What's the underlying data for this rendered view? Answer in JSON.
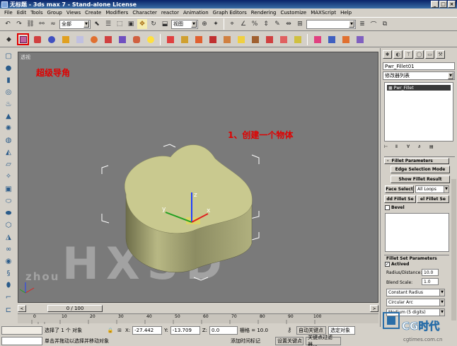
{
  "window": {
    "title": "无标题 - 3ds max 7 - Stand-alone License",
    "min": "_",
    "max": "□",
    "close": "×"
  },
  "menu": [
    "File",
    "Edit",
    "Tools",
    "Group",
    "Views",
    "Create",
    "Modifiers",
    "Character",
    "reactor",
    "Animation",
    "Graph Editors",
    "Rendering",
    "Customize",
    "MAXScript",
    "Help"
  ],
  "toolbar": {
    "selection_filter": "全部",
    "ref_coord": "视图",
    "named_selection": ""
  },
  "viewport": {
    "label": "透视",
    "annotation_title": "超级导角",
    "annotation_step": "1、创建一个物体",
    "watermark": "HXSD",
    "watermark_sub": "zhou",
    "axis_x": "x",
    "axis_y": "y",
    "axis_z": "z",
    "colors": {
      "background": "#7a7a7a",
      "object_top": "#c9c98f",
      "object_side": "#a8a876",
      "annotation": "#e00000"
    }
  },
  "command_panel": {
    "object_name": "Pwr_Fillet01",
    "modifier_list": "修改器列表",
    "stack_item": "Pwr_Fillet",
    "rollout_fillet": "Fillet Parameters",
    "edge_selection_mode": "Edge Selection Mode",
    "show_fillet_result": "Show Fillet Result",
    "face_select": "Face Select",
    "face_select_value": "All Loops",
    "add_fillet_set": "dd Fillet Se",
    "del_fillet_set": "el Fillet Se",
    "bevel": "Bevel",
    "rollout_fillet_set": "Fillet Set Parameters",
    "actived": "Actived",
    "radius_label": "Radius/Distance:",
    "radius_value": "10.0",
    "blend_label": "Blend Scale:",
    "blend_value": "1.0",
    "constant_radius": "Constant Radius",
    "circular_arc": "Circular Arc",
    "medium": "Medium (5 digits)"
  },
  "timeslider": {
    "frame": "0 / 100",
    "prev": "<",
    "next": ">"
  },
  "trackbar": {
    "ticks": [
      "0",
      "10",
      "20",
      "30",
      "40",
      "50",
      "60",
      "70",
      "80",
      "90",
      "100"
    ]
  },
  "status": {
    "selected": "选择了 1 个 对象",
    "x_label": "X:",
    "x_value": "-27.442",
    "y_label": "Y:",
    "y_value": "-13.709",
    "z_label": "Z:",
    "z_value": "0.0",
    "grid": "栅格 = 10.0",
    "auto_key": "自动关键点",
    "selected_object": "选定对象",
    "prompt": "单击并拖动以选择并移动对象",
    "add_time_tag": "添加时间标记",
    "set_key": "设置关键点",
    "key_filters": "关键点过滤器..."
  },
  "logo": {
    "text": "CG时代",
    "url": "cgtimes.com.cn"
  }
}
